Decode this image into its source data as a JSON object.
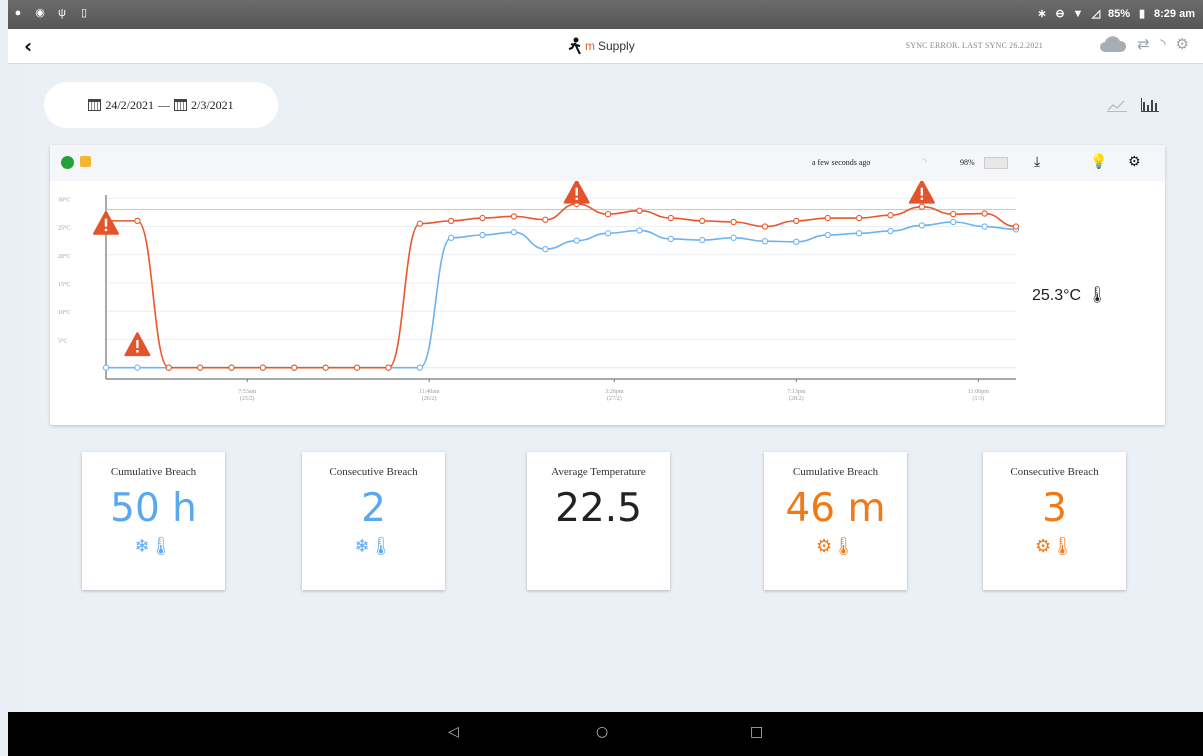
{
  "statusbar": {
    "battery": "85%",
    "time": "8:29 am"
  },
  "header": {
    "brand_m": "m",
    "brand_rest": "Supply",
    "sync_status": "SYNC ERROR. LAST SYNC 26.2.2021"
  },
  "date_range": {
    "from": "24/2/2021",
    "separator": "—",
    "to": "2/3/2021"
  },
  "sensor": {
    "last_seen": "a few seconds ago",
    "battery": "98%",
    "current_temperature": "25.3°C"
  },
  "colors": {
    "hot": "#e8582b",
    "cold": "#6db3f2",
    "status_ok": "#22a33a"
  },
  "chart_data": {
    "type": "line",
    "y_ticks": [
      "30°C",
      "25°C",
      "20°C",
      "15°C",
      "10°C",
      "5°C"
    ],
    "x_ticks": [
      {
        "time": "7:53am",
        "date": "(25/2)"
      },
      {
        "time": "11:40am",
        "date": "(26/2)"
      },
      {
        "time": "3:26pm",
        "date": "(27/2)"
      },
      {
        "time": "7:13pm",
        "date": "(28/2)"
      },
      {
        "time": "11:00pm",
        "date": "(1/3)"
      }
    ],
    "ylim": [
      -2,
      32
    ],
    "reference_line": 28,
    "series": [
      {
        "color": "#e8582b",
        "values": [
          26,
          26,
          0,
          0,
          0,
          0,
          0,
          0,
          0,
          0,
          25.5,
          26,
          26.5,
          26.8,
          26.2,
          29,
          27.2,
          27.8,
          26.5,
          26,
          25.8,
          25,
          26,
          26.5,
          26.5,
          27,
          28.5,
          27.2,
          27.3,
          25
        ]
      },
      {
        "color": "#6db3f2",
        "values": [
          0,
          0,
          0,
          0,
          0,
          0,
          0,
          0,
          0,
          0,
          0,
          23,
          23.5,
          24,
          21,
          22.5,
          23.8,
          24.3,
          22.8,
          22.6,
          23,
          22.4,
          22.3,
          23.5,
          23.8,
          24.2,
          25.2,
          25.8,
          25,
          24.5
        ]
      }
    ],
    "alerts": [
      {
        "index": 0,
        "value": 25.5
      },
      {
        "index": 1,
        "value": 4
      },
      {
        "index": 15,
        "value": 31
      },
      {
        "index": 26,
        "value": 31
      }
    ]
  },
  "stats": [
    {
      "title": "Cumulative Breach",
      "value": "50 h",
      "kind": "cold",
      "icon": "cold-thermometer-icon"
    },
    {
      "title": "Consecutive Breach",
      "value": "2",
      "kind": "cold",
      "icon": "cold-thermometer-icon"
    },
    {
      "title": "Average Temperature",
      "value": "22.5",
      "kind": "neutral",
      "icon": ""
    },
    {
      "title": "Cumulative Breach",
      "value": "46 m",
      "kind": "hot",
      "icon": "hot-thermometer-icon"
    },
    {
      "title": "Consecutive Breach",
      "value": "3",
      "kind": "hot",
      "icon": "hot-thermometer-icon"
    }
  ]
}
